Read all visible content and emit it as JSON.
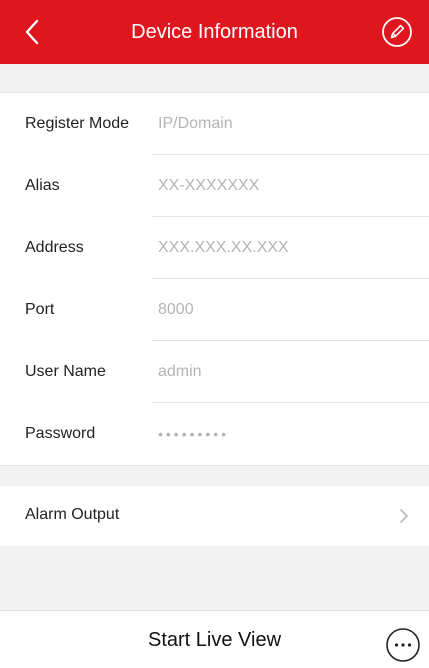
{
  "header": {
    "title": "Device Information",
    "back_icon": "chevron-left-icon",
    "edit_icon": "pencil-icon",
    "color": "#e0161e"
  },
  "info": {
    "rows": [
      {
        "label": "Register Mode",
        "value": "IP/Domain"
      },
      {
        "label": "Alias",
        "value": "XX-XXXXXXX"
      },
      {
        "label": "Address",
        "value": "XXX.XXX.XX.XXX"
      },
      {
        "label": "Port",
        "value": "8000"
      },
      {
        "label": "User Name",
        "value": "admin"
      },
      {
        "label": "Password",
        "value": "•••••••••"
      }
    ]
  },
  "alarm": {
    "label": "Alarm Output",
    "chevron_icon": "chevron-right-icon"
  },
  "footer": {
    "start_label": "Start Live View",
    "more_icon": "more-icon"
  }
}
